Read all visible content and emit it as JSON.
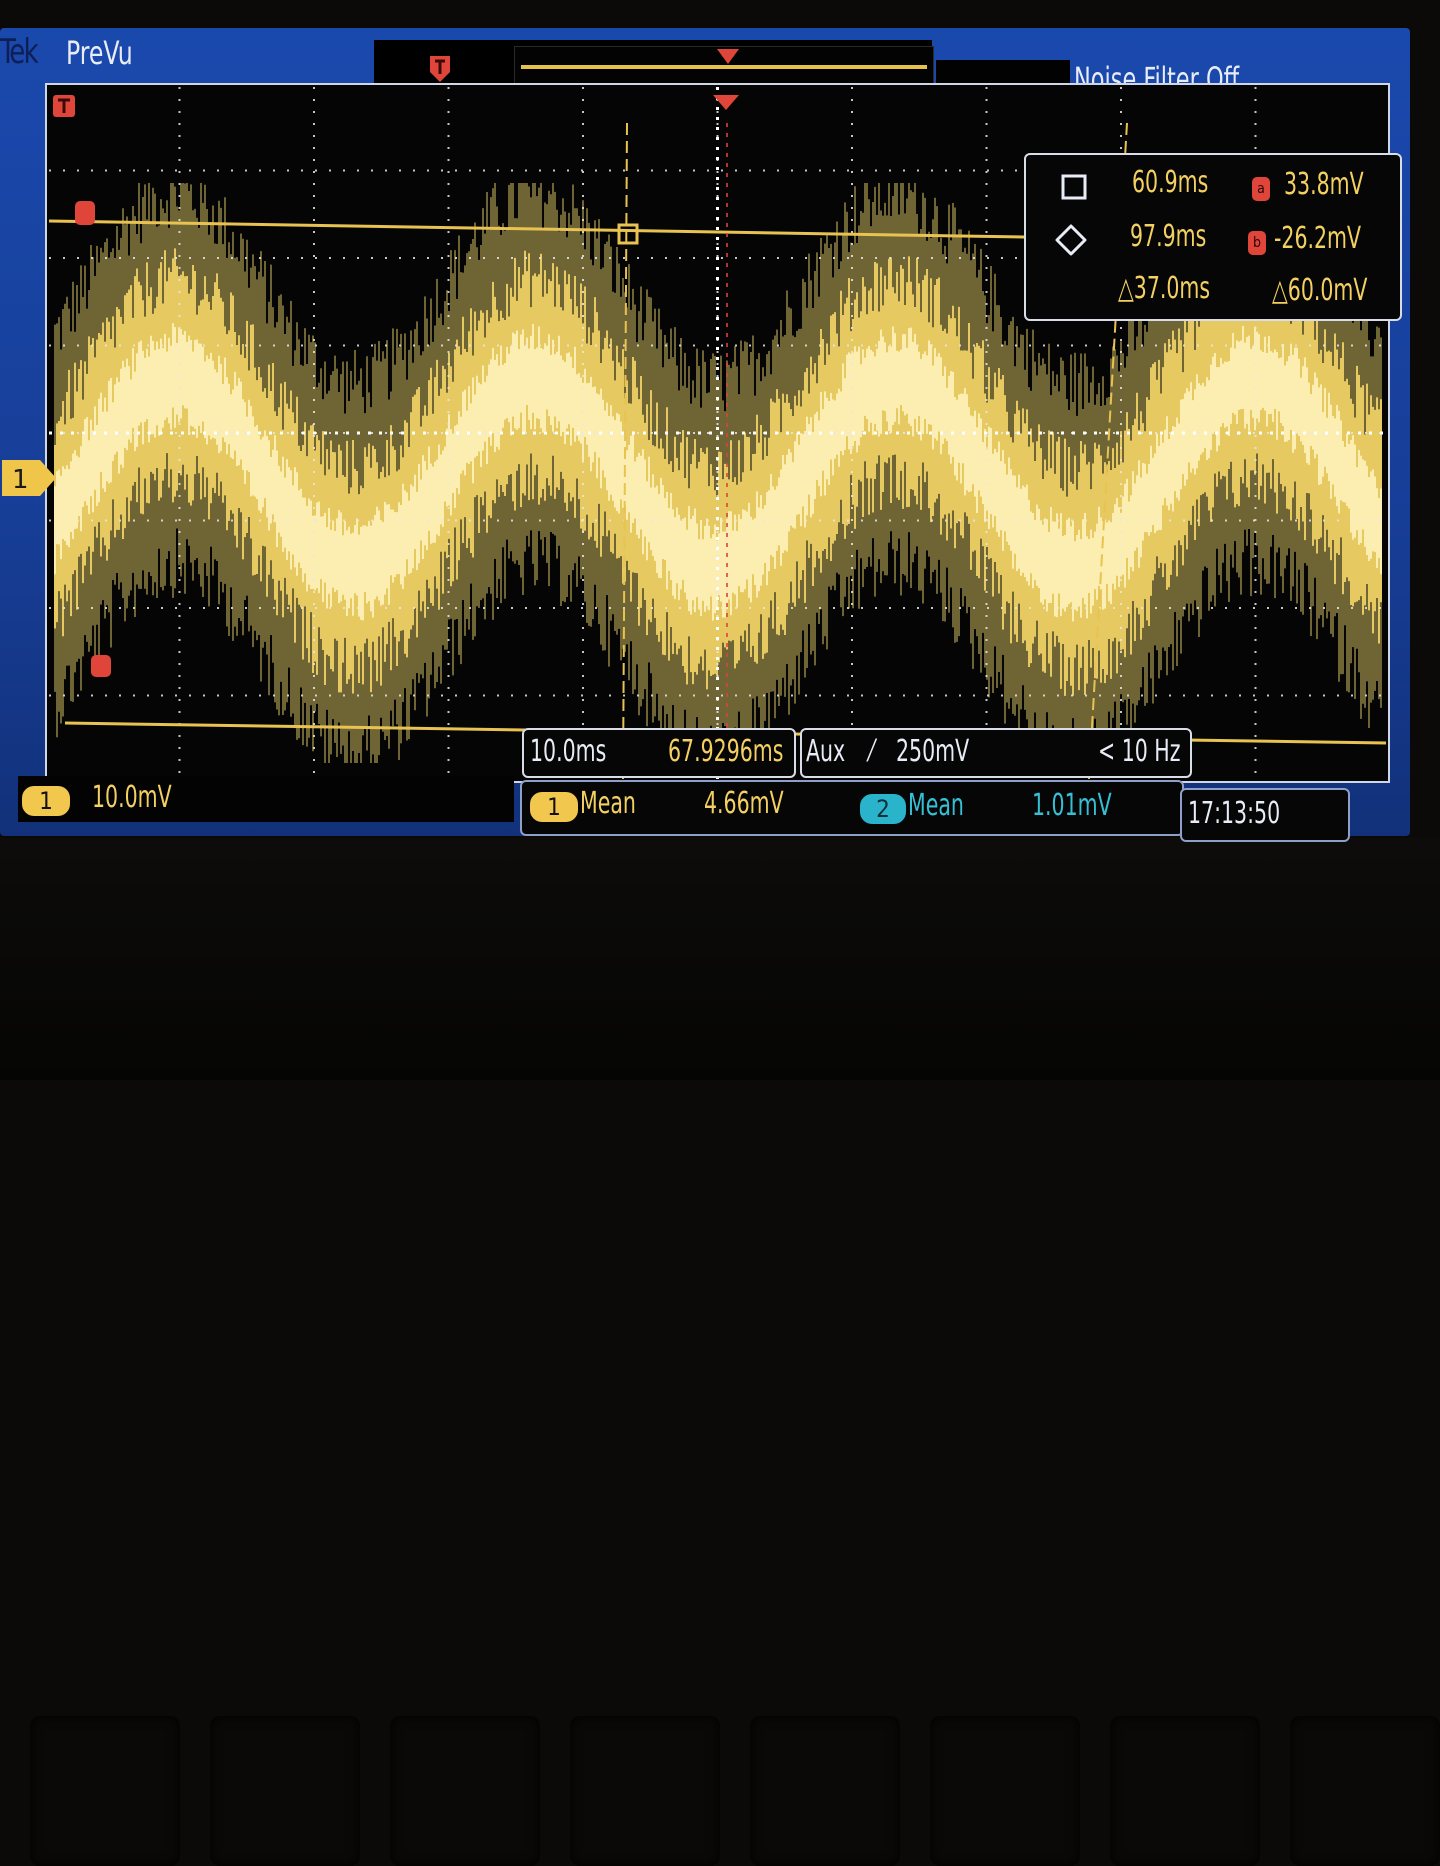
{
  "header": {
    "brand_fragment": "Tek",
    "mode": "PreVu",
    "noise_filter": "Noise Filter Off"
  },
  "colors": {
    "ch1_trace": "#f3d466",
    "ch2": "#2fb6cf",
    "cursor_ref": "#e04040",
    "screen_blue": "#1b47a8"
  },
  "ch1": {
    "marker": "1"
  },
  "cursor_readout": {
    "cursor_a_time": "60.9ms",
    "cursor_a_volt_label": "a",
    "cursor_a_volt": "33.8mV",
    "cursor_b_time": "97.9ms",
    "cursor_b_volt_label": "b",
    "cursor_b_volt": "-26.2mV",
    "delta_time": "△37.0ms",
    "delta_volt": "△60.0mV"
  },
  "horizontal": {
    "scale": "10.0ms",
    "position": "67.9296ms"
  },
  "trigger": {
    "source": "Aux",
    "slope_glyph": "⁄",
    "level": "250mV",
    "frequency": "< 10 Hz"
  },
  "ch1_scale": {
    "channel": "1",
    "value": "10.0mV"
  },
  "measurements": [
    {
      "channel": "1",
      "label": "Mean",
      "value": "4.66mV"
    },
    {
      "channel": "2",
      "label": "Mean",
      "value": "1.01mV"
    }
  ],
  "clock": "17:13:50",
  "icons": {
    "cursor_a_shape": "square-icon",
    "cursor_b_shape": "circle-icon",
    "trigger_marker": "trigger-t-icon"
  }
}
